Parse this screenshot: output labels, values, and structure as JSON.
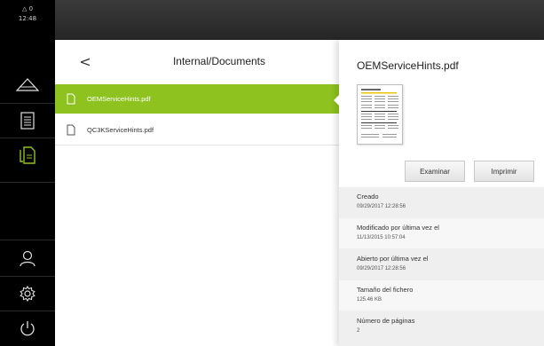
{
  "status": {
    "warning_count": "0",
    "time": "12:48"
  },
  "rail": {
    "items": [
      {
        "icon": "measure-triangle-icon"
      },
      {
        "icon": "document-list-icon"
      },
      {
        "icon": "file-manager-icon",
        "active": true
      },
      {
        "icon": "user-icon"
      },
      {
        "icon": "settings-gear-icon"
      },
      {
        "icon": "power-icon"
      }
    ]
  },
  "file_list": {
    "back_label": "<",
    "path": "Internal/Documents",
    "files": [
      {
        "name": "OEMServiceHints.pdf",
        "selected": true
      },
      {
        "name": "QC3KServiceHints.pdf",
        "selected": false
      }
    ]
  },
  "details": {
    "title": "OEMServiceHints.pdf",
    "buttons": {
      "examine": "Examinar",
      "print": "Imprimir"
    },
    "info": [
      {
        "label": "Creado",
        "value": "09/29/2017 12:28:56"
      },
      {
        "label": "Modificado por última vez el",
        "value": "11/13/2015 10:57:04"
      },
      {
        "label": "Abierto por última vez el",
        "value": "09/29/2017 12:28:56"
      },
      {
        "label": "Tamaño del fichero",
        "value": "125.46 KB"
      },
      {
        "label": "Número de páginas",
        "value": "2"
      }
    ]
  },
  "colors": {
    "accent": "#8dc21f",
    "rail": "#000000",
    "active_icon": "#8dc21f"
  }
}
